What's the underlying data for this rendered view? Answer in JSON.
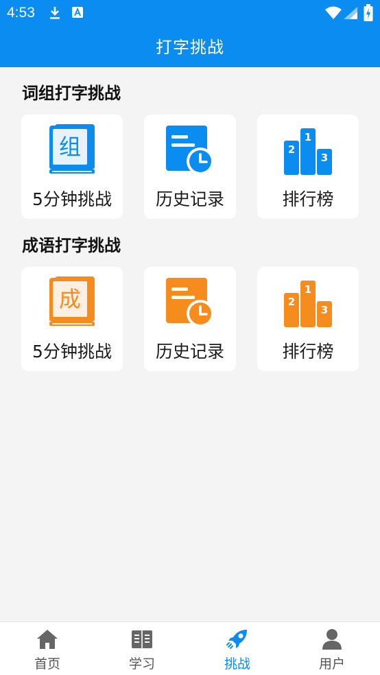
{
  "status_bar": {
    "time": "4:53"
  },
  "app_bar": {
    "title": "打字挑战"
  },
  "sections": [
    {
      "title": "词组打字挑战",
      "accent": "#0a8cf0",
      "book_char": "组",
      "cards": [
        {
          "label": "5分钟挑战",
          "icon": "book-icon"
        },
        {
          "label": "历史记录",
          "icon": "history-clock-icon"
        },
        {
          "label": "排行榜",
          "icon": "podium-icon",
          "ranks": [
            "1",
            "2",
            "3"
          ]
        }
      ]
    },
    {
      "title": "成语打字挑战",
      "accent": "#f78c1e",
      "book_char": "成",
      "cards": [
        {
          "label": "5分钟挑战",
          "icon": "book-icon"
        },
        {
          "label": "历史记录",
          "icon": "history-clock-icon"
        },
        {
          "label": "排行榜",
          "icon": "podium-icon",
          "ranks": [
            "1",
            "2",
            "3"
          ]
        }
      ]
    }
  ],
  "bottom_nav": [
    {
      "label": "首页",
      "icon": "home-icon",
      "active": false
    },
    {
      "label": "学习",
      "icon": "open-book-icon",
      "active": false
    },
    {
      "label": "挑战",
      "icon": "rocket-icon",
      "active": true
    },
    {
      "label": "用户",
      "icon": "user-icon",
      "active": false
    }
  ],
  "colors": {
    "primary": "#0a8cf0",
    "orange": "#f78c1e",
    "inactive_nav": "#555555"
  }
}
